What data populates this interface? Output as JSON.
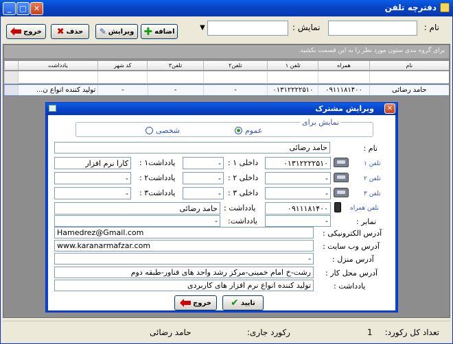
{
  "window": {
    "title": "دفترچه تلفن",
    "controls": {
      "minimize": "_",
      "maximize": "□",
      "close": "✕"
    }
  },
  "search": {
    "name_label": "نام :",
    "name_value": "",
    "display_label": "نمایش :",
    "display_value": "",
    "dropdown_value": ""
  },
  "toolbar": {
    "add": "اضافه",
    "edit": "ویرایش",
    "delete": "حذف",
    "exit": "خروج"
  },
  "grid": {
    "group_hint": "برای گروه بندی ستون مورد نظر را به این قسمت بکشید.",
    "columns": [
      "نام",
      "همراه",
      "تلفن ۱",
      "تلفن۲",
      "تلفن۳",
      "کد شهر",
      "یادداشت"
    ],
    "row": [
      "حامد رضائی",
      "۰۹۱۱۱۸۱۴۰۰",
      "۰۱۳۱۲۲۲۲۵۱۰",
      "-",
      "-",
      "-",
      "تولید کننده انواع ن..."
    ]
  },
  "status": {
    "total_label": "تعداد کل رکورد:",
    "total_value": "1",
    "current_label": "رکورد جاری:",
    "current_value": "حامد رضائی"
  },
  "dialog": {
    "title": "ویرایش مشترک",
    "display_for_legend": "نمایش برای",
    "radio_public": "عموم",
    "radio_private": "شخصی",
    "name_label": "نام :",
    "name_value": "حامد رضائی",
    "phone1": {
      "label": "تلفن ۱",
      "value": "۰۱۳۱۲۲۲۲۵۱۰",
      "ext_label": "داخلی ۱ :",
      "ext_value": "-",
      "note_label": "یادداشت۱ :",
      "note_value": "کارا نرم افزار"
    },
    "phone2": {
      "label": "تلفن ۲",
      "value": "-",
      "ext_label": "داخلی ۲ :",
      "ext_value": "-",
      "note_label": "یادداشت۲ :",
      "note_value": "-"
    },
    "phone3": {
      "label": "تلفن ۳",
      "value": "-",
      "ext_label": "داخلی ۳ :",
      "ext_value": "-",
      "note_label": "یادداشت۳ :",
      "note_value": "-"
    },
    "mobile": {
      "label": "تلفن همراه",
      "value": "۰۹۱۱۱۸۱۴۰۰",
      "note_label": "یادداشت :",
      "note_value": "حامد رضائی"
    },
    "fax": {
      "label": "نمابر :",
      "value": "-",
      "note_label": "یادداشت:",
      "note_value": "-"
    },
    "email_label": "آدرس الکترونیکی :",
    "email_value": "Hamedrez@Gmail.com",
    "website_label": "آدرس وب سایت :",
    "website_value": "www.karanarmafzar.com",
    "home_label": "آدرس منزل :",
    "home_value": "-",
    "work_label": "آدرس محل کار :",
    "work_value": "رشت-خ امام خمینی-مرکز رشد واحد های فناور-طبقه دوم",
    "note_label": "یادداشت :",
    "note_value": "تولید کننده انواع نرم افزار های کاربردی",
    "ok_button": "تایید",
    "exit_button": "خروج"
  },
  "colors": {
    "titlebar": "#0845c9",
    "accent": "#3a52b8",
    "window_bg": "#ece9d8"
  }
}
